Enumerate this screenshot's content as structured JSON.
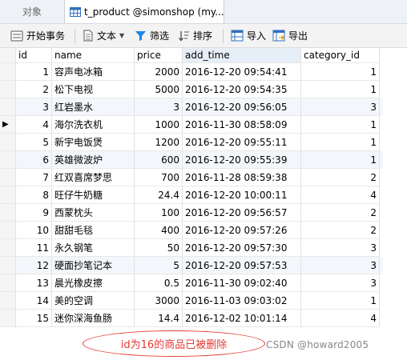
{
  "tabs": [
    {
      "label": "对象"
    },
    {
      "label": "t_product @simonshop (my..."
    }
  ],
  "toolbar": {
    "begin_tx": "开始事务",
    "text": "文本",
    "filter": "筛选",
    "sort": "排序",
    "import": "导入",
    "export": "导出"
  },
  "table": {
    "columns": [
      "id",
      "name",
      "price",
      "add_time",
      "category_id"
    ],
    "rows": [
      [
        "1",
        "容声电冰箱",
        "2000",
        "2016-12-20 09:54:41",
        "1"
      ],
      [
        "2",
        "松下电视",
        "5000",
        "2016-12-20 09:54:35",
        "1"
      ],
      [
        "3",
        "红岩墨水",
        "3",
        "2016-12-20 09:56:05",
        "3"
      ],
      [
        "4",
        "海尔洗衣机",
        "1000",
        "2016-11-30 08:58:09",
        "1"
      ],
      [
        "5",
        "新宇电饭煲",
        "1200",
        "2016-12-20 09:55:11",
        "1"
      ],
      [
        "6",
        "英雄微波炉",
        "600",
        "2016-12-20 09:55:39",
        "1"
      ],
      [
        "7",
        "红双喜席梦思",
        "700",
        "2016-11-28 08:59:38",
        "2"
      ],
      [
        "8",
        "旺仔牛奶糖",
        "24.4",
        "2016-12-20 10:00:11",
        "4"
      ],
      [
        "9",
        "西蒙枕头",
        "100",
        "2016-12-20 09:56:57",
        "2"
      ],
      [
        "10",
        "甜甜毛毯",
        "400",
        "2016-12-20 09:57:26",
        "2"
      ],
      [
        "11",
        "永久钢笔",
        "50",
        "2016-12-20 09:57:30",
        "3"
      ],
      [
        "12",
        "硬面抄笔记本",
        "5",
        "2016-12-20 09:57:53",
        "3"
      ],
      [
        "13",
        "晨光橡皮擦",
        "0.5",
        "2016-11-30 09:02:40",
        "3"
      ],
      [
        "14",
        "美的空调",
        "3000",
        "2016-11-03 09:03:02",
        "1"
      ],
      [
        "15",
        "迷你深海鱼肠",
        "14.4",
        "2016-12-02 10:01:14",
        "4"
      ]
    ],
    "current_row_indicator": "▶"
  },
  "annotation": "id为16的商品已被删除",
  "watermark": "CSDN @howard2005",
  "colors": {
    "annotation": "#e53935",
    "accent_filter": "#1e88e5"
  }
}
